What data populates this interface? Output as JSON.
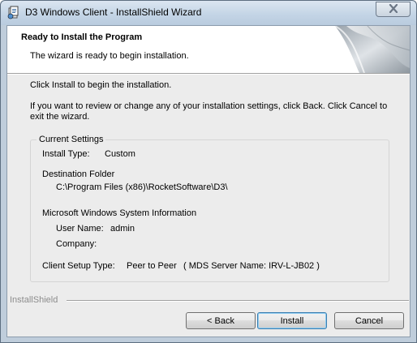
{
  "window": {
    "title": "D3 Windows Client - InstallShield Wizard"
  },
  "banner": {
    "title": "Ready to Install the Program",
    "subtitle": "The wizard is ready to begin installation."
  },
  "body": {
    "instruction": "Click Install to begin the installation.",
    "review_text": "If you want to review or change any of your installation settings, click Back. Click Cancel to exit the wizard."
  },
  "settings": {
    "legend": "Current Settings",
    "install_type_label": "Install Type:",
    "install_type_value": "Custom",
    "destination_label": "Destination Folder",
    "destination_value": "C:\\Program Files (x86)\\RocketSoftware\\D3\\",
    "ms_info_label": "Microsoft Windows System Information",
    "user_name_label": "User Name:",
    "user_name_value": "admin",
    "company_label": "Company:",
    "company_value": "",
    "client_setup_label": "Client Setup Type:",
    "client_setup_value": "Peer to Peer",
    "server_name": "( MDS Server Name:  IRV-L-JB02 )"
  },
  "footer": {
    "brand": "InstallShield",
    "back_label": "< Back",
    "install_label": "Install",
    "cancel_label": "Cancel"
  },
  "icons": {
    "app": "installer-icon",
    "close": "close-icon",
    "banner": "page-curl-graphic"
  }
}
